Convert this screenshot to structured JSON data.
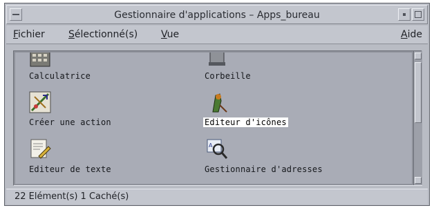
{
  "window": {
    "title": "Gestionnaire d'applications – Apps_bureau"
  },
  "menubar": {
    "items": [
      {
        "mnemonic": "F",
        "rest": "ichier"
      },
      {
        "mnemonic": "S",
        "rest": "électionné(s)"
      },
      {
        "mnemonic": "V",
        "rest": "ue"
      }
    ],
    "help": {
      "mnemonic": "A",
      "rest": "ide"
    }
  },
  "icons": [
    {
      "label": "Calculatrice",
      "icon": "calculator-icon",
      "selected": false
    },
    {
      "label": "Corbeille",
      "icon": "trash-icon",
      "selected": false
    },
    {
      "label": "Créer une action",
      "icon": "create-action-icon",
      "selected": false
    },
    {
      "label": "Editeur d'icônes",
      "icon": "icon-editor-icon",
      "selected": true
    },
    {
      "label": "Editeur de texte",
      "icon": "text-editor-icon",
      "selected": false
    },
    {
      "label": "Gestionnaire d'adresses",
      "icon": "address-manager-icon",
      "selected": false
    }
  ],
  "statusbar": {
    "text": "22 Elément(s) 1 Caché(s)"
  },
  "colors": {
    "window_bg": "#b9bcc4",
    "pane_bg": "#a9acb6",
    "selection": "#ffffff"
  }
}
